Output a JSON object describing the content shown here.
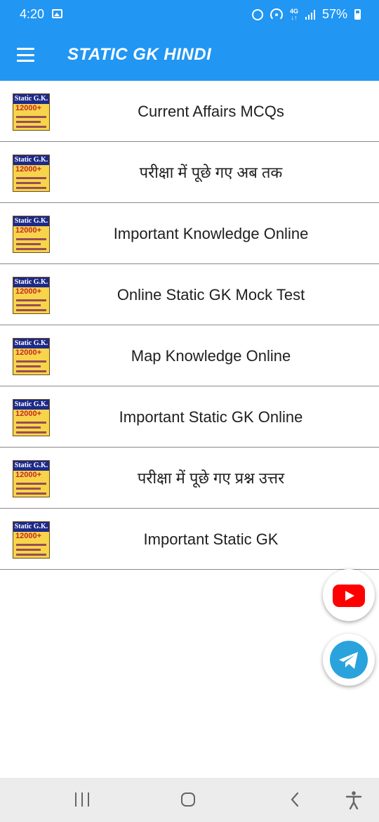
{
  "status_bar": {
    "time": "4:20",
    "network_top": "4G",
    "network_bottom": "↓↑",
    "battery": "57%"
  },
  "app_bar": {
    "title": "STATIC GK HINDI",
    "menu_icon": "hamburger-menu-icon"
  },
  "thumbnail": {
    "title": "Static G.K.",
    "count": "12000+"
  },
  "list": {
    "items": [
      {
        "label": "Current Affairs MCQs"
      },
      {
        "label": "परीक्षा में पूछे गए अब तक"
      },
      {
        "label": "Important Knowledge Online"
      },
      {
        "label": "Online Static GK Mock Test"
      },
      {
        "label": "Map Knowledge Online"
      },
      {
        "label": "Important Static GK Online"
      },
      {
        "label": "परीक्षा में पूछे गए प्रश्न उत्तर"
      },
      {
        "label": "Important Static GK"
      }
    ]
  },
  "fabs": {
    "youtube": "youtube-icon",
    "telegram": "telegram-icon"
  },
  "nav_bar": {
    "recent": "recent-apps-icon",
    "home": "home-icon",
    "back": "back-icon",
    "accessibility": "accessibility-icon"
  },
  "colors": {
    "primary": "#2196f3",
    "youtube_red": "#ff0000",
    "telegram_blue": "#2aa3dd",
    "divider": "#8a8a8a"
  }
}
